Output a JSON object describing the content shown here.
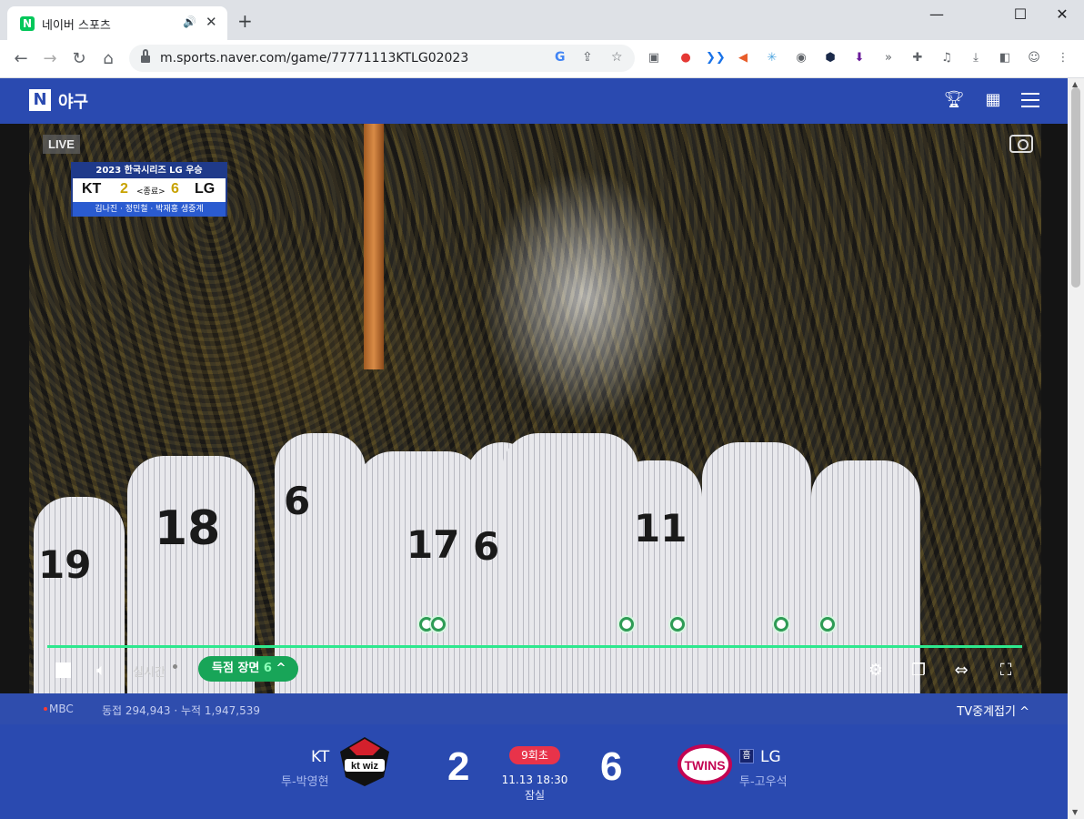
{
  "browser": {
    "tab_title": "네이버 스포츠",
    "favicon_letter": "N",
    "audio_icon": "🔊",
    "close_glyph": "✕",
    "new_tab_glyph": "+",
    "minimize_glyph": "—",
    "maximize_glyph": "☐",
    "window_close_glyph": "✕",
    "url": "m.sports.naver.com/game/77771113KTLG02023",
    "back_glyph": "←",
    "forward_glyph": "→",
    "reload_glyph": "↻",
    "home_glyph": "⌂"
  },
  "site": {
    "logo_letter": "N",
    "section": "야구"
  },
  "player": {
    "live_label": "LIVE",
    "scorebug": {
      "title": "2023 한국시리즈 LG 우승",
      "away_team": "KT",
      "away_score": "2",
      "status": "<종료>",
      "home_score": "6",
      "home_team": "LG",
      "casters": "김나진 · 정민철 · 박재홍 생중계"
    },
    "jersey_numbers": [
      "19",
      "18",
      "6",
      "17",
      "6",
      "11"
    ],
    "realtime_label": "실시간",
    "highlight_label": "득점 장면",
    "highlight_count": "6",
    "highlight_chevron": "^",
    "scoring_marker_count": 6
  },
  "broadcast": {
    "channel": "MBC",
    "concurrent": "동접 294,943",
    "cumulative": "누적 1,947,539",
    "tv_toggle_label": "TV중계접기 ^"
  },
  "game": {
    "away": {
      "name": "KT",
      "pitcher": "투-박영현",
      "score": "2"
    },
    "home": {
      "name": "LG",
      "pitcher": "투-고우석",
      "score": "6",
      "home_badge": "홈"
    },
    "inning": "9회초",
    "datetime": "11.13 18:30",
    "venue": "잠실"
  },
  "colors": {
    "naver_blue": "#2a4ab0",
    "progress_green": "#2ee88e",
    "highlight_green": "#18a558",
    "inning_red": "#e8334a"
  }
}
